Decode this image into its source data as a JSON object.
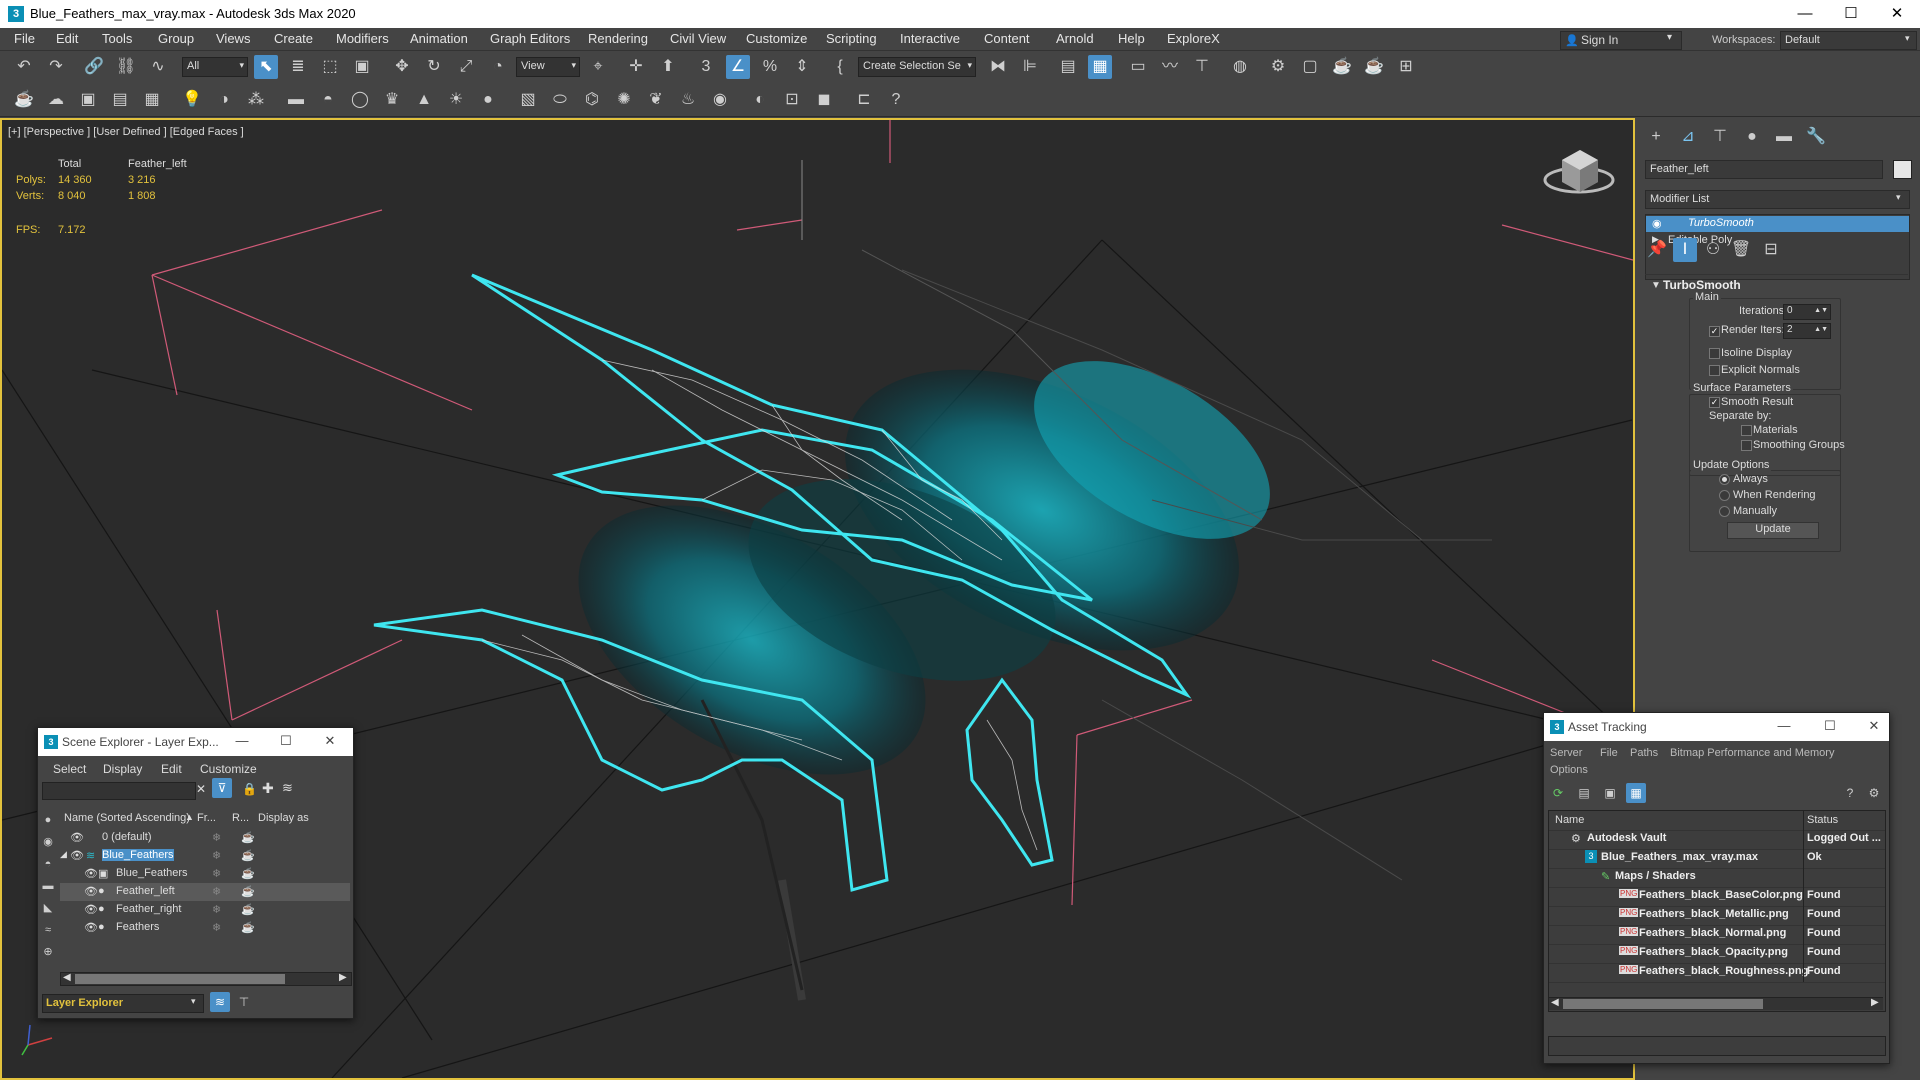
{
  "app": {
    "title": "Blue_Feathers_max_vray.max - Autodesk 3ds Max 2020",
    "icon_letter": "3",
    "window_controls": [
      "—",
      "☐",
      "✕"
    ]
  },
  "menu": {
    "items": [
      "File",
      "Edit",
      "Tools",
      "Group",
      "Views",
      "Create",
      "Modifiers",
      "Animation",
      "Graph Editors",
      "Rendering",
      "Civil View",
      "Customize",
      "Scripting",
      "Interactive",
      "Content",
      "Arnold",
      "Help",
      "ExploreX"
    ],
    "sign_in": "Sign In",
    "workspaces_label": "Workspaces:",
    "workspaces_value": "Default"
  },
  "toolbar": {
    "selection_filter": "All",
    "ref_coord": "View",
    "selection_set": "Create Selection Se"
  },
  "viewport": {
    "label": "[+] [Perspective ] [User Defined ] [Edged Faces ]",
    "stats": {
      "col_total": "Total",
      "col_object": "Feather_left",
      "polys_label": "Polys:",
      "polys_total": "14 360",
      "polys_object": "3 216",
      "verts_label": "Verts:",
      "verts_total": "8 040",
      "verts_object": "1 808",
      "fps_label": "FPS:",
      "fps_value": "7.172"
    }
  },
  "command_panel": {
    "object_name": "Feather_left",
    "modifier_list": "Modifier List",
    "stack": [
      "TurboSmooth",
      "Editable Poly"
    ],
    "rollout_title": "TurboSmooth",
    "main_label": "Main",
    "iterations_label": "Iterations:",
    "iterations_value": "0",
    "render_iters_label": "Render Iters:",
    "render_iters_value": "2",
    "isoline_label": "Isoline Display",
    "explicit_normals_label": "Explicit Normals",
    "surface_params_label": "Surface Parameters",
    "smooth_result_label": "Smooth Result",
    "separate_by_label": "Separate by:",
    "materials_label": "Materials",
    "smoothing_groups_label": "Smoothing Groups",
    "update_options_label": "Update Options",
    "always_label": "Always",
    "when_rendering_label": "When Rendering",
    "manually_label": "Manually",
    "update_button": "Update"
  },
  "scene_explorer": {
    "title": "Scene Explorer - Layer Exp...",
    "menu": [
      "Select",
      "Display",
      "Edit",
      "Customize"
    ],
    "columns": [
      "Name (Sorted Ascending)",
      "Fr...",
      "R...",
      "Display as"
    ],
    "rows": [
      {
        "name": "0 (default)",
        "level": 1
      },
      {
        "name": "Blue_Feathers",
        "level": 1
      },
      {
        "name": "Blue_Feathers",
        "level": 2
      },
      {
        "name": "Feather_left",
        "level": 2
      },
      {
        "name": "Feather_right",
        "level": 2
      },
      {
        "name": "Feathers",
        "level": 2
      }
    ],
    "footer_select": "Layer Explorer"
  },
  "asset_tracking": {
    "title": "Asset Tracking",
    "menu_row1": [
      "Server",
      "File",
      "Paths",
      "Bitmap Performance and Memory"
    ],
    "menu_row2": [
      "Options"
    ],
    "col_name": "Name",
    "col_status": "Status",
    "rows": [
      {
        "name": "Autodesk Vault",
        "status": "Logged Out ..."
      },
      {
        "name": "Blue_Feathers_max_vray.max",
        "status": "Ok"
      },
      {
        "name": "Maps / Shaders",
        "status": ""
      },
      {
        "name": "Feathers_black_BaseColor.png",
        "status": "Found"
      },
      {
        "name": "Feathers_black_Metallic.png",
        "status": "Found"
      },
      {
        "name": "Feathers_black_Normal.png",
        "status": "Found"
      },
      {
        "name": "Feathers_black_Opacity.png",
        "status": "Found"
      },
      {
        "name": "Feathers_black_Roughness.png",
        "status": "Found"
      }
    ]
  },
  "colors": {
    "accent": "#4a90c8",
    "viewport_border": "#e2c23d",
    "feather_cyan": "#3fe6f0",
    "grid_red": "#d05a78"
  }
}
